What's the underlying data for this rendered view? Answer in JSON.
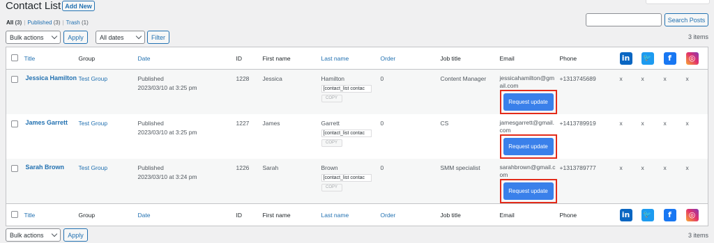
{
  "page": {
    "title": "Contact List",
    "add_new": "Add New",
    "views": [
      {
        "label": "All",
        "count": "(3)"
      },
      {
        "label": "Published",
        "count": "(3)"
      },
      {
        "label": "Trash",
        "count": "(1)"
      }
    ],
    "view_sep": "|",
    "search_button": "Search Posts",
    "search_value": "",
    "items_count": "3 items"
  },
  "toolbar_top": {
    "bulk_actions": "Bulk actions",
    "apply": "Apply",
    "dates": "All dates",
    "filter": "Filter"
  },
  "toolbar_bottom": {
    "bulk_actions": "Bulk actions",
    "apply": "Apply"
  },
  "columns": {
    "title": "Title",
    "group": "Group",
    "date": "Date",
    "id": "ID",
    "first_name": "First name",
    "last_name": "Last name",
    "order": "Order",
    "job_title": "Job title",
    "email": "Email",
    "phone": "Phone"
  },
  "social": {
    "linkedin": "in",
    "twitter": "🐦",
    "facebook": "f",
    "instagram": "◎"
  },
  "icons": {
    "linkedin": "linkedin-icon",
    "twitter": "twitter-icon",
    "facebook": "facebook-icon",
    "instagram": "instagram-icon"
  },
  "rows": [
    {
      "title": "Jessica Hamilton",
      "group": "Test Group",
      "status": "Published",
      "date": "2023/03/10 at 3:25 pm",
      "id": "1228",
      "first_name": "Jessica",
      "last_name": "Hamilton",
      "shortcode": "[contact_list contac",
      "copy": "COPY",
      "order": "0",
      "job_title": "Content Manager",
      "email": "jessicahamilton@gmail.com",
      "request_update": "Request update",
      "phone": "+1313745689",
      "li": "x",
      "tw": "x",
      "fb": "x",
      "ig": "x"
    },
    {
      "title": "James Garrett",
      "group": "Test Group",
      "status": "Published",
      "date": "2023/03/10 at 3:25 pm",
      "id": "1227",
      "first_name": "James",
      "last_name": "Garrett",
      "shortcode": "[contact_list contac",
      "copy": "COPY",
      "order": "0",
      "job_title": "CS",
      "email": "jamesgarrett@gmail.com",
      "request_update": "Request update",
      "phone": "+1413789919",
      "li": "x",
      "tw": "x",
      "fb": "x",
      "ig": "x"
    },
    {
      "title": "Sarah Brown",
      "group": "Test Group",
      "status": "Published",
      "date": "2023/03/10 at 3:24 pm",
      "id": "1226",
      "first_name": "Sarah",
      "last_name": "Brown",
      "shortcode": "[contact_list contac",
      "copy": "COPY",
      "order": "0",
      "job_title": "SMM specialist",
      "email": "sarahbrown@gmail.com",
      "request_update": "Request update",
      "phone": "+1313789777",
      "li": "x",
      "tw": "x",
      "fb": "x",
      "ig": "x"
    }
  ],
  "colors": {
    "accent": "#2271b1",
    "request_button": "#3a80ea",
    "highlight": "#e32b1a"
  }
}
